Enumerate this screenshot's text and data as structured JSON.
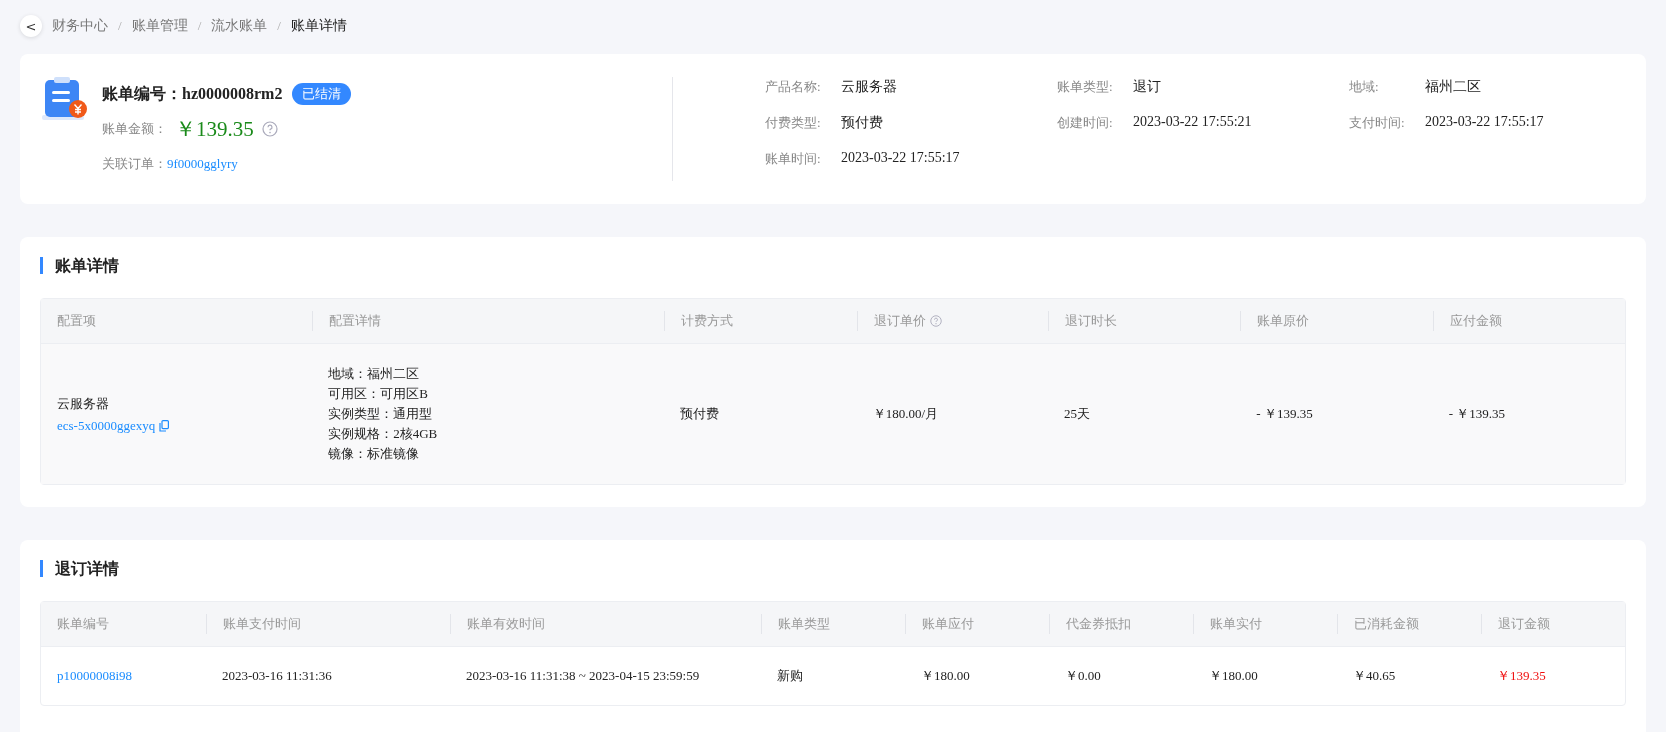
{
  "breadcrumb": {
    "back": "<",
    "items": [
      {
        "label": "财务中心",
        "current": false
      },
      {
        "label": "账单管理",
        "current": false
      },
      {
        "label": "流水账单",
        "current": false
      },
      {
        "label": "账单详情",
        "current": true
      }
    ],
    "separator": "/"
  },
  "summary": {
    "bill_label": "账单编号：",
    "bill_no": "hz0000008rm2",
    "status": "已结清",
    "amount_label": "账单金额：",
    "amount": "￥139.35",
    "order_label": "关联订单：",
    "order_no": "9f0000gglyry",
    "fields": [
      {
        "label": "产品名称:",
        "value": "云服务器"
      },
      {
        "label": "账单类型:",
        "value": "退订"
      },
      {
        "label": "地域:",
        "value": "福州二区"
      },
      {
        "label": "付费类型:",
        "value": "预付费"
      },
      {
        "label": "创建时间:",
        "value": "2023-03-22 17:55:21"
      },
      {
        "label": "支付时间:",
        "value": "2023-03-22 17:55:17"
      },
      {
        "label": "账单时间:",
        "value": "2023-03-22 17:55:17"
      }
    ]
  },
  "bill_details": {
    "title": "账单详情",
    "columns": [
      {
        "label": "配置项",
        "help": false
      },
      {
        "label": "配置详情",
        "help": false
      },
      {
        "label": "计费方式",
        "help": false
      },
      {
        "label": "退订单价",
        "help": true
      },
      {
        "label": "退订时长",
        "help": false
      },
      {
        "label": "账单原价",
        "help": false
      },
      {
        "label": "应付金额",
        "help": false
      }
    ],
    "rows": [
      {
        "cells": [
          {
            "kind": "product",
            "text": "云服务器",
            "link": "ecs-5x0000ggexyq"
          },
          {
            "kind": "lines",
            "lines": [
              "地域：福州二区",
              "可用区：可用区B",
              "实例类型：通用型",
              "实例规格：2核4GB",
              "镜像：标准镜像"
            ]
          },
          {
            "kind": "text",
            "text": "预付费"
          },
          {
            "kind": "text",
            "text": "￥180.00/月"
          },
          {
            "kind": "text",
            "text": "25天"
          },
          {
            "kind": "text",
            "text": "- ￥139.35"
          },
          {
            "kind": "text",
            "text": "- ￥139.35"
          }
        ]
      }
    ]
  },
  "refund_details": {
    "title": "退订详情",
    "columns": [
      "账单编号",
      "账单支付时间",
      "账单有效时间",
      "账单类型",
      "账单应付",
      "代金券抵扣",
      "账单实付",
      "已消耗金额",
      "退订金额"
    ],
    "rows": [
      {
        "cells": [
          {
            "kind": "link",
            "text": "p10000008i98"
          },
          {
            "kind": "text",
            "text": "2023-03-16 11:31:36"
          },
          {
            "kind": "text",
            "text": "2023-03-16 11:31:38 ~ 2023-04-15 23:59:59"
          },
          {
            "kind": "text",
            "text": "新购"
          },
          {
            "kind": "text",
            "text": "￥180.00"
          },
          {
            "kind": "text",
            "text": "￥0.00"
          },
          {
            "kind": "text",
            "text": "￥180.00"
          },
          {
            "kind": "text",
            "text": "￥40.65"
          },
          {
            "kind": "alert",
            "text": "￥139.35"
          }
        ]
      }
    ]
  }
}
